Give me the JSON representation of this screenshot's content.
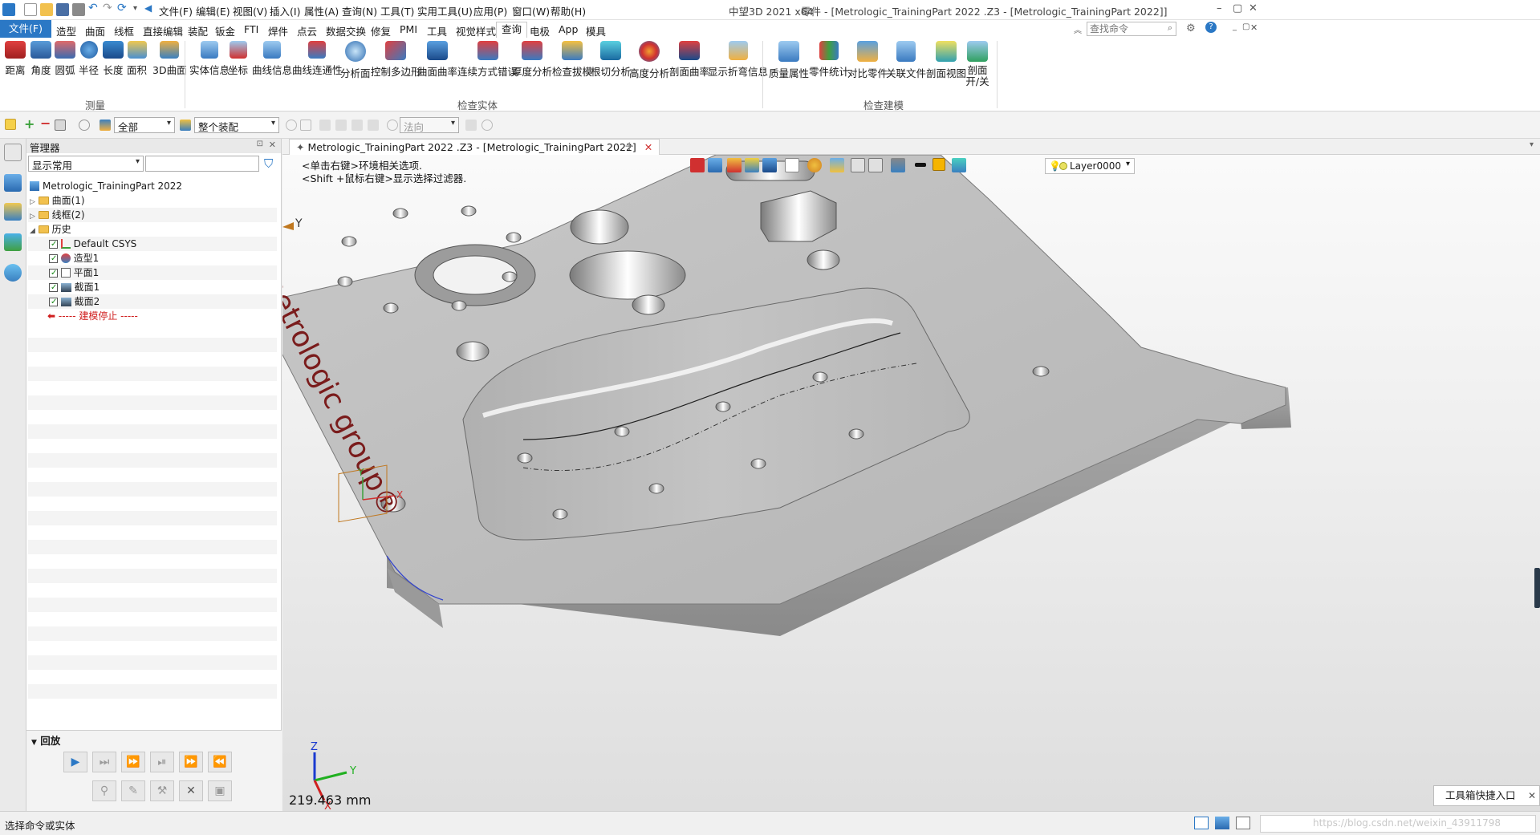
{
  "titlebar": {
    "menus": [
      "文件(F)",
      "编辑(E)",
      "视图(V)",
      "插入(I)",
      "属性(A)",
      "查询(N)",
      "工具(T)",
      "实用工具(U)",
      "应用(P)",
      "窗口(W)",
      "帮助(H)"
    ],
    "app_name": "中望3D 2021 x64",
    "doc_title": "零件 - [Metrologic_TrainingPart  2022 .Z3 - [Metrologic_TrainingPart  2022]]",
    "window_buttons": [
      "–",
      "▢",
      "✕"
    ]
  },
  "tabs": {
    "file": "文件(F)",
    "items": [
      "造型",
      "曲面",
      "线框",
      "直接编辑",
      "装配",
      "钣金",
      "FTI",
      "焊件",
      "点云",
      "数据交换",
      "修复",
      "PMI",
      "工具",
      "视觉样式",
      "查询",
      "电极",
      "App",
      "模具"
    ],
    "search_placeholder": "查找命令"
  },
  "ribbon": {
    "groups": [
      "测量",
      "检查实体",
      "检查建模"
    ],
    "measure": [
      "距离",
      "角度",
      "圆弧",
      "半径",
      "长度",
      "面积",
      "3D曲面"
    ],
    "inspect_entity": [
      "实体信息",
      "坐标",
      "曲线信息",
      "曲线连通性",
      "分析面",
      "控制多边形",
      "曲面曲率",
      "连续方式错误",
      "厚度分析",
      "检查拔模",
      "根切分析",
      "高度分析",
      "剖面曲率",
      "显示折弯信息"
    ],
    "inspect_model": [
      "质量属性",
      "零件统计",
      "对比零件",
      "关联文件",
      "剖面视图",
      "剖面 开/关"
    ]
  },
  "filterbar": {
    "filter_value": "全部",
    "assembly_value": "整个装配",
    "direction_placeholder": "法向"
  },
  "manager": {
    "title": "管理器",
    "display_value": "显示常用",
    "tree": {
      "root": "Metrologic_TrainingPart  2022",
      "surface": "曲面(1)",
      "wireframe": "线框(2)",
      "history": "历史",
      "history_items": [
        "Default CSYS",
        "造型1",
        "平面1",
        "截面1",
        "截面2"
      ],
      "stop": "----- 建模停止 -----"
    }
  },
  "playback": {
    "title": "回放",
    "buttons_row1": [
      "▶",
      "⏭",
      "⏩",
      "⏯",
      "⏩",
      "⏪"
    ],
    "buttons_row2": [
      "⚲",
      "✎",
      "⚒",
      "✕",
      "▣"
    ]
  },
  "document": {
    "tab_title": "Metrologic_TrainingPart  2022 .Z3 - [Metrologic_TrainingPart  2022]",
    "hint_line1": "<单击右键>环境相关选项.",
    "hint_line2": "<Shift +鼠标右键>显示选择过滤器.",
    "layer": "Layer0000",
    "engraving": "metrologic group®",
    "axis_labels": {
      "x": "X",
      "y": "Y",
      "z": "Z"
    },
    "scale": "219.463 mm",
    "quick_entry": "工具箱快捷入口"
  },
  "status": {
    "text": "选择命令或实体",
    "watermark": "https://blog.csdn.net/weixin_43911798"
  },
  "colors": {
    "file_tab": "#2b78c5",
    "part_face": "#bdbdbd",
    "engraving": "#7a1c1c",
    "layer_swatch": "#f5b400"
  }
}
